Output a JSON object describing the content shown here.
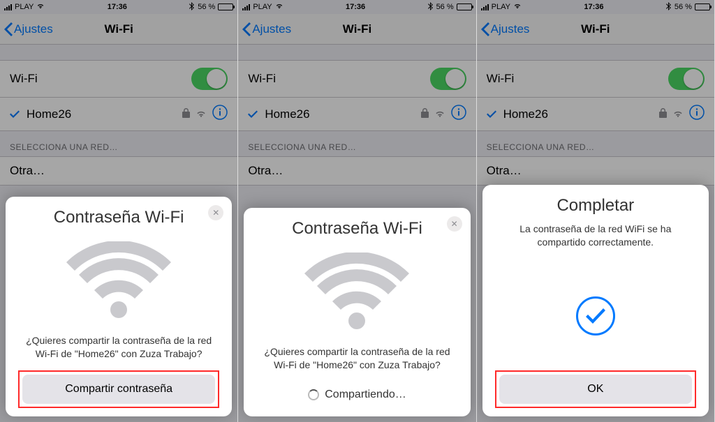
{
  "status": {
    "carrier": "PLAY",
    "time": "17:36",
    "battery_pct": "56 %"
  },
  "nav": {
    "back": "Ajustes",
    "title": "Wi-Fi"
  },
  "wifi": {
    "toggle_label": "Wi-Fi",
    "connected_ssid": "Home26",
    "section_header": "SELECCIONA UNA RED…",
    "other": "Otra…"
  },
  "card1": {
    "title": "Contraseña Wi-Fi",
    "text": "¿Quieres compartir la contraseña de la red Wi-Fi de \"Home26\" con Zuza Trabajo?",
    "button": "Compartir contraseña"
  },
  "card2": {
    "title": "Contraseña Wi-Fi",
    "text": "¿Quieres compartir la contraseña de la red Wi-Fi de \"Home26\" con Zuza Trabajo?",
    "sharing": "Compartiendo…"
  },
  "card3": {
    "title": "Completar",
    "text": "La contraseña de la red WiFi se ha compartido correctamente.",
    "button": "OK"
  }
}
